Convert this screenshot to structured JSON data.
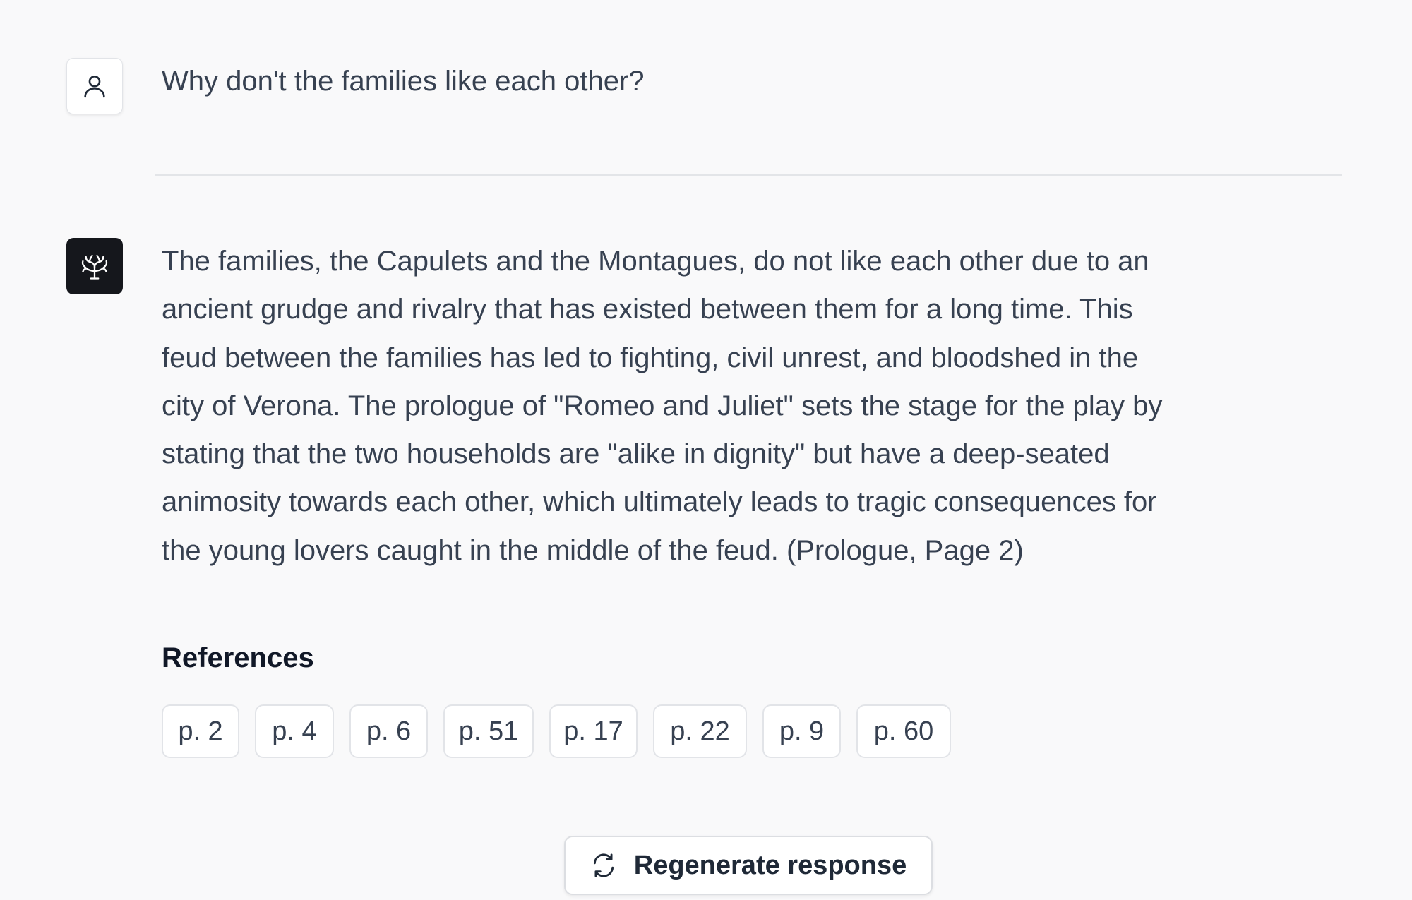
{
  "conversation": {
    "user_message": "Why don't the families like each other?",
    "assistant_lines": [
      "The families, the Capulets and the Montagues, do not like each other due to an",
      "ancient grudge and rivalry that has existed between them for a long time. This",
      "feud between the families has led to fighting, civil unrest, and bloodshed in the",
      "city of Verona. The prologue of \"Romeo and Juliet\" sets the stage for the play by",
      "stating that the two households are \"alike in dignity\" but have a deep-seated",
      "animosity towards each other, which ultimately leads to tragic consequences for",
      "the young lovers caught in the middle of the feud. (Prologue, Page 2)"
    ]
  },
  "references": {
    "title": "References",
    "pages": [
      "p. 2",
      "p. 4",
      "p. 6",
      "p. 51",
      "p. 17",
      "p. 22",
      "p. 9",
      "p. 60"
    ]
  },
  "regenerate": {
    "label": "Regenerate response"
  },
  "icons": {
    "user_avatar": "user-icon",
    "assistant_avatar": "coral-logo-icon",
    "regenerate": "refresh-icon"
  },
  "colors": {
    "background": "#f9f9fa",
    "text": "#374151",
    "assistant_avatar_bg": "#15171c"
  }
}
